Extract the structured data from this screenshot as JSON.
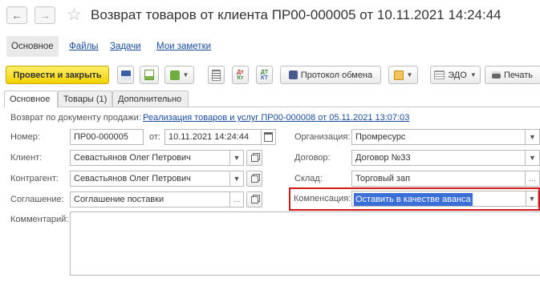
{
  "window": {
    "title": "Возврат товаров от клиента ПР00-000005 от 10.11.2021 14:24:44"
  },
  "sections": [
    "Основное",
    "Файлы",
    "Задачи",
    "Мои заметки"
  ],
  "toolbar": {
    "post_close": "Провести и закрыть",
    "exchange_protocol": "Протокол обмена",
    "edo": "ЭДО",
    "print": "Печать"
  },
  "tabs": [
    "Основное",
    "Товары (1)",
    "Дополнительно"
  ],
  "form": {
    "basis_label": "Возврат по документу продажи:",
    "basis_link": "Реализация товаров и услуг ПР00-000008 от 05.11.2021 13:07:03",
    "number_label": "Номер:",
    "number_value": "ПР00-000005",
    "date_label": "от:",
    "date_value": "10.11.2021 14:24:44",
    "org_label": "Организация:",
    "org_value": "Промресурс",
    "client_label": "Клиент:",
    "client_value": "Севастьянов Олег Петрович",
    "contract_label": "Договор:",
    "contract_value": "Договор №33",
    "counterparty_label": "Контрагент:",
    "counterparty_value": "Севастьянов Олег Петрович",
    "warehouse_label": "Склад:",
    "warehouse_value": "Торговый зап",
    "agreement_label": "Соглашение:",
    "agreement_value": "Соглашение поставки",
    "compensation_label": "Компенсация:",
    "compensation_value": "Оставить в качестве аванса",
    "comment_label": "Комментарий:",
    "comment_value": ""
  },
  "colors": {
    "primary_button": "#f2d100",
    "link": "#1a4c9c",
    "highlight_border": "#d01818",
    "selection": "#3a6fd8"
  }
}
